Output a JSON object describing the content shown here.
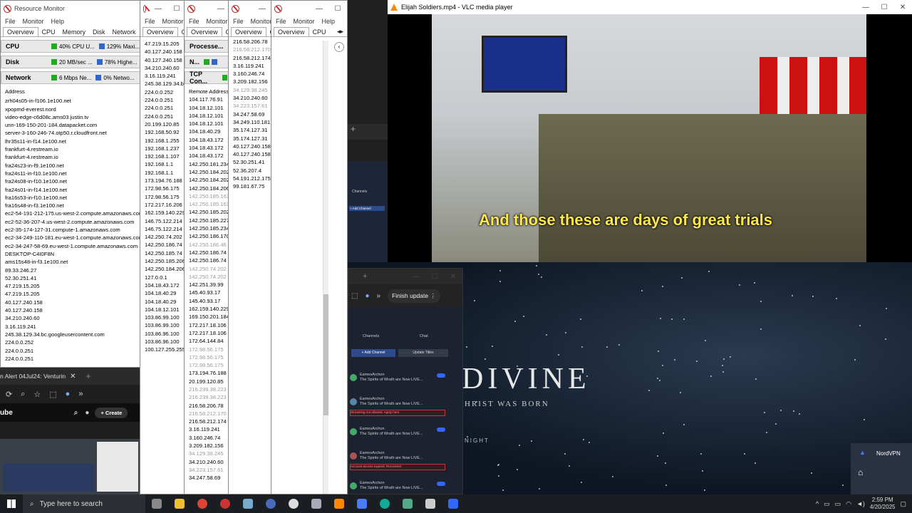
{
  "resmon1": {
    "title": "Resource Monitor",
    "menu": [
      "File",
      "Monitor",
      "Help"
    ],
    "tabs": [
      "Overview",
      "CPU",
      "Memory",
      "Disk",
      "Network"
    ],
    "cpu": {
      "label": "CPU",
      "m1": "40% CPU U...",
      "m2": "129% Maxi..."
    },
    "disk": {
      "label": "Disk",
      "m1": "20 MB/sec ...",
      "m2": "78% Highe..."
    },
    "network": {
      "label": "Network",
      "m1": "6 Mbps Ne...",
      "m2": "0% Netwo..."
    },
    "col": "Address",
    "rows": [
      "zrh04s05-in-f106.1e100.net",
      "xpopmd-everest.nord",
      "video-edge-c6d08c.ams03.justin.tv",
      "unn-169-150-201-184.datapacket.com",
      "server-3-160-246-74.otp50.r.cloudfront.net",
      "lhr35s11-in-f14.1e100.net",
      "frankfurt-4.restream.io",
      "frankfurt-4.restream.io",
      "fra24s23-in-f9.1e100.net",
      "fra24s11-in-f10.1e100.net",
      "fra24s08-in-f10.1e100.net",
      "fra24s01-in-f14.1e100.net",
      "fra16s53-in-f10.1e100.net",
      "fra16s48-in-f3.1e100.net",
      "ec2-54-191-212-175.us-west-2.compute.amazonaws.com",
      "ec2-52-36-207-4.us-west-2.compute.amazonaws.com",
      "ec2-35-174-127-31.compute-1.amazonaws.com",
      "ec2-34-249-110-181.eu-west-1.compute.amazonaws.com",
      "ec2-34-247-58-69.eu-west-1.compute.amazonaws.com",
      "DESKTOP-C4I0F8N",
      "ams15s48-in-f3.1e100.net",
      "89.33.246.27",
      "52.30.251.41",
      "47.219.15.205",
      "47.219.15.205",
      "40.127.240.158",
      "40.127.240.158",
      "34.210.240.60",
      "3.16.119.241",
      "245.38.129.34.bc.googleusercontent.com",
      "224.0.0.252",
      "224.0.0.251",
      "224.0.0.251"
    ]
  },
  "resmon2": {
    "menu": [
      "File",
      "Monitor"
    ],
    "tabs": [
      "Overview",
      "CPU"
    ],
    "rows": [
      "47.219.15.205",
      "40.127.240.158",
      "40.127.240.158",
      "34.210.240.60",
      "3.16.119.241",
      "245.38.129.34.bc...",
      "224.0.0.252",
      "224.0.0.251",
      "224.0.0.251",
      "224.0.0.251",
      "20.199.120.85",
      "192.168.50.92",
      "192.168.1.255",
      "192.168.1.237",
      "192.168.1.107",
      "192.168.1.1",
      "192.168.1.1",
      "173.194.76.188",
      "172.98.56.175",
      "172.98.56.175",
      "172.217.16.206",
      "162.159.140.229",
      "146.75.122.214",
      "146.75.122.214",
      "142.250.74.202",
      "142.250.186.74",
      "142.250.185.74",
      "142.250.185.206",
      "142.250.184.206",
      "127.0.0.1",
      "104.18.43.172",
      "104.18.40.29",
      "104.18.40.29",
      "104.18.12.101",
      "103.86.99.100",
      "103.86.99.100",
      "103.86.96.100",
      "103.86.96.100",
      "100.127.255.255"
    ]
  },
  "resmon3": {
    "menu": [
      "File",
      "Monitor"
    ],
    "tabs": [
      "Overview",
      "CPU"
    ],
    "processes": "Processe...",
    "network": "N...",
    "tcp": "TCP Con...",
    "col": "Remote Address",
    "rows": [
      "104.117.76.91",
      "104.18.12.101",
      "104.18.12.101",
      "104.18.12.101",
      "104.18.40.29",
      "104.18.43.172",
      "104.18.43.172",
      "104.18.43.172",
      "142.250.181.234",
      "142.250.184.202",
      "142.250.184.202",
      "142.250.184.206",
      "142.250.185.163",
      "142.250.185.163",
      "142.250.185.202",
      "142.250.185.227",
      "142.250.185.234",
      "142.250.186.170",
      "142.250.186.46",
      "142.250.186.74",
      "142.250.186.74",
      "142.250.74.202",
      "142.250.74.202",
      "142.251.39.99",
      "145.40.93.17",
      "145.40.93.17",
      "162.159.140.229",
      "169.150.201.184",
      "172.217.18.106",
      "172.217.18.106",
      "172.64.144.84",
      "172.98.56.175",
      "172.98.56.175",
      "172.98.56.175",
      "173.194.76.188",
      "20.199.120.85",
      "216.239.38.223",
      "216.239.38.223",
      "216.58.206.78",
      "216.58.212.170",
      "216.58.212.174",
      "3.16.119.241",
      "3.160.246.74",
      "3.209.182.156",
      "34.129.38.245",
      "34.210.240.60",
      "34.223.157.61",
      "34.247.58.69"
    ],
    "dim": [
      12,
      13,
      18,
      21,
      22,
      31,
      32,
      33,
      36,
      37,
      39,
      44,
      46
    ]
  },
  "resmon4": {
    "menu": [
      "File",
      "Monitor"
    ],
    "tabs": [
      "Overview",
      "CPU"
    ],
    "rows": [
      "216.58.206.78",
      "216.58.212.170",
      "216.58.212.174",
      "3.16.119.241",
      "3.160.246.74",
      "3.209.182.156",
      "34.129.38.245",
      "34.210.240.60",
      "34.223.157.61",
      "34.247.58.69",
      "34.249.110.181",
      "35.174.127.31",
      "35.174.127.31",
      "40.127.240.158",
      "40.127.240.158",
      "52.30.251.41",
      "52.36.207.4",
      "54.191.212.175",
      "99.181.67.75"
    ],
    "dim": [
      1,
      6,
      8
    ]
  },
  "resmon5": {
    "menu": [
      "File",
      "Monitor",
      "Help"
    ],
    "tabs": [
      "Overview",
      "CPU"
    ]
  },
  "vlc": {
    "title": "Elijah Soldiers.mp4 - VLC media player",
    "subtitle": "And those these are days of great trials"
  },
  "background": {
    "divine": "DIVINE",
    "sub": "HRIST WAS BORN",
    "night": "NIGHT"
  },
  "browser": {
    "finish_update": "Finish update",
    "channels": "Channels",
    "chat": "Chat",
    "add_channel": "+ Add Channel",
    "update_titles": "Update Titles",
    "channel_name": "EamesArchon",
    "channel_title": "The Spirits of Wrath are Now LIVE...",
    "error1": "Streaming not allowed. Apply here",
    "error2": "Account access expired. Reconnect"
  },
  "browser2": {
    "tab": "n Alert 04Jul24: Venturin",
    "create": "+ Create",
    "yt": "ube"
  },
  "nordvpn": {
    "label": "NordVPN"
  },
  "taskbar": {
    "search": "Type here to search",
    "time": "2:59 PM",
    "date": "4/20/2025"
  },
  "colors": {
    "accent": "#3366ff",
    "taskbar": "#1a1d22"
  }
}
